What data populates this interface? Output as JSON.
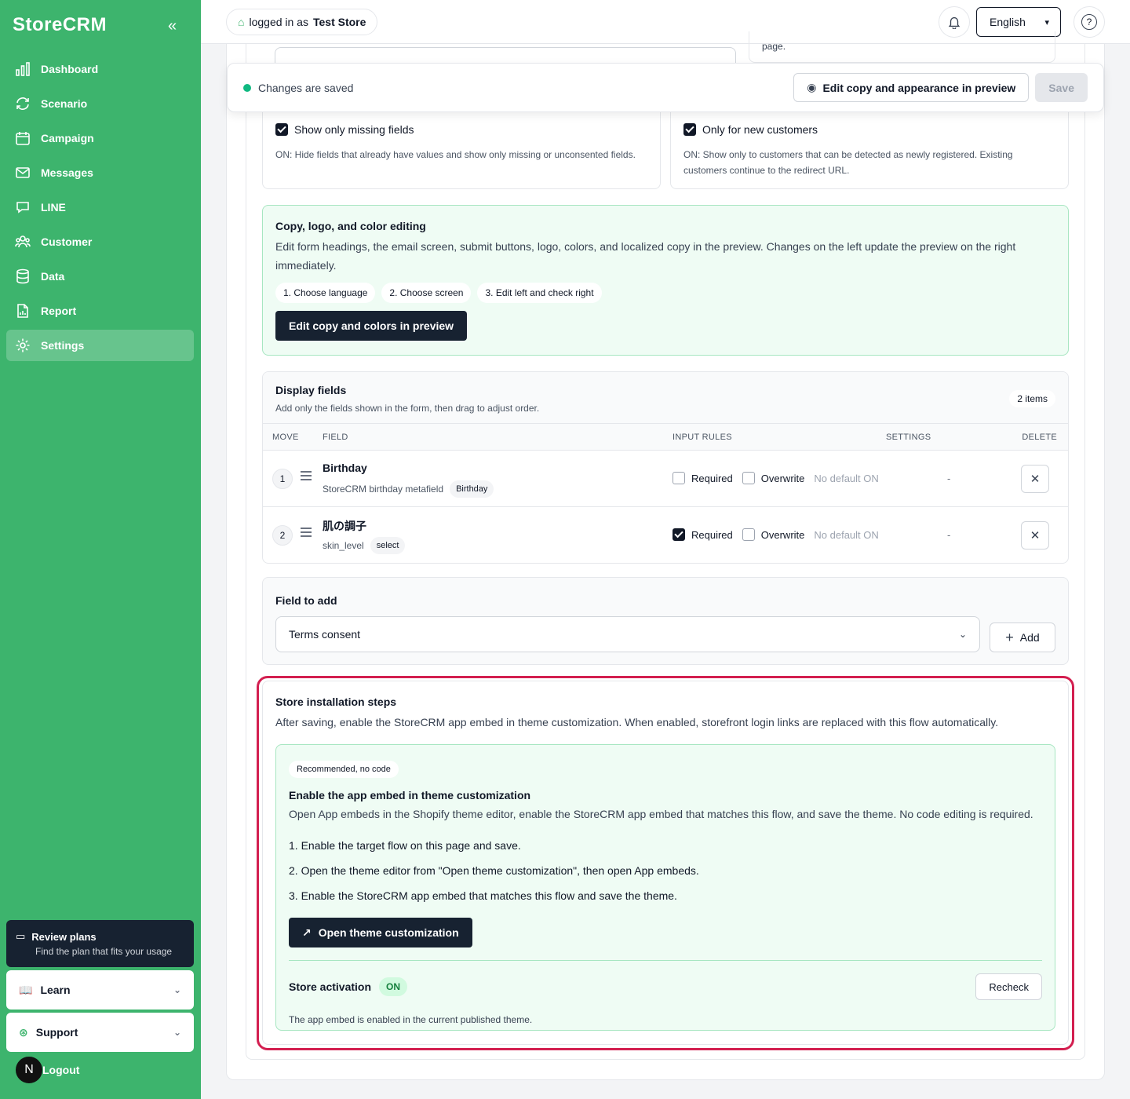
{
  "sidebar": {
    "brand": "StoreCRM",
    "collapse_icon": "double-chevron-left-icon",
    "items": [
      {
        "label": "Dashboard",
        "icon": "bar-chart-icon"
      },
      {
        "label": "Scenario",
        "icon": "refresh-icon"
      },
      {
        "label": "Campaign",
        "icon": "calendar-icon"
      },
      {
        "label": "Messages",
        "icon": "mail-icon"
      },
      {
        "label": "LINE",
        "icon": "chat-icon"
      },
      {
        "label": "Customer",
        "icon": "users-icon"
      },
      {
        "label": "Data",
        "icon": "database-icon"
      },
      {
        "label": "Report",
        "icon": "report-icon"
      },
      {
        "label": "Settings",
        "icon": "gear-icon",
        "active": true
      }
    ],
    "plans": {
      "title": "Review plans",
      "subtitle": "Find the plan that fits your usage"
    },
    "learn": "Learn",
    "support": "Support",
    "logout": "Logout",
    "avatar_letter": "N"
  },
  "topbar": {
    "logged_in_prefix": "logged in as",
    "store_name": "Test Store",
    "language": "English"
  },
  "peek": {
    "text": "page."
  },
  "savebar": {
    "status": "Changes are saved",
    "edit_button": "Edit copy and appearance in preview",
    "save_button": "Save"
  },
  "options": [
    {
      "label": "Show only missing fields",
      "checked": true,
      "desc": "ON: Hide fields that already have values and show only missing or unconsented fields."
    },
    {
      "label": "Only for new customers",
      "checked": true,
      "desc": "ON: Show only to customers that can be detected as newly registered. Existing customers continue to the redirect URL."
    }
  ],
  "copy_card": {
    "title": "Copy, logo, and color editing",
    "desc": "Edit form headings, the email screen, submit buttons, logo, colors, and localized copy in the preview. Changes on the left update the preview on the right immediately.",
    "chips": [
      "1. Choose language",
      "2. Choose screen",
      "3. Edit left and check right"
    ],
    "button": "Edit copy and colors in preview"
  },
  "display_fields": {
    "title": "Display fields",
    "subtitle": "Add only the fields shown in the form, then drag to adjust order.",
    "count": "2 items",
    "columns": {
      "move": "MOVE",
      "field": "FIELD",
      "input_rules": "INPUT RULES",
      "settings": "SETTINGS",
      "delete": "DELETE"
    },
    "rows": [
      {
        "num": "1",
        "name": "Birthday",
        "key": "StoreCRM birthday metafield",
        "tag": "Birthday",
        "required": false,
        "required_label": "Required",
        "overwrite_label": "Overwrite",
        "default": "No default ON",
        "settings": "-"
      },
      {
        "num": "2",
        "name": "肌の調子",
        "key": "skin_level",
        "tag": "select",
        "required": true,
        "required_label": "Required",
        "overwrite_label": "Overwrite",
        "default": "No default ON",
        "settings": "-"
      }
    ]
  },
  "add_field": {
    "label": "Field to add",
    "selected": "Terms consent",
    "button": "Add"
  },
  "install": {
    "title": "Store installation steps",
    "desc": "After saving, enable the StoreCRM app embed in theme customization. When enabled, storefront login links are replaced with this flow automatically.",
    "badge": "Recommended, no code",
    "subtitle": "Enable the app embed in theme customization",
    "subdesc": "Open App embeds in the Shopify theme editor, enable the StoreCRM app embed that matches this flow, and save the theme. No code editing is required.",
    "steps": [
      "1. Enable the target flow on this page and save.",
      "2. Open the theme editor from \"Open theme customization\", then open App embeds.",
      "3. Enable the StoreCRM app embed that matches this flow and save the theme."
    ],
    "button": "Open theme customization",
    "activation_label": "Store activation",
    "activation_status": "ON",
    "recheck": "Recheck",
    "activation_desc": "The app embed is enabled in the current published theme."
  },
  "colors": {
    "sidebar_green": "#3db46d",
    "dark": "#172231",
    "highlight": "#d31f50"
  }
}
